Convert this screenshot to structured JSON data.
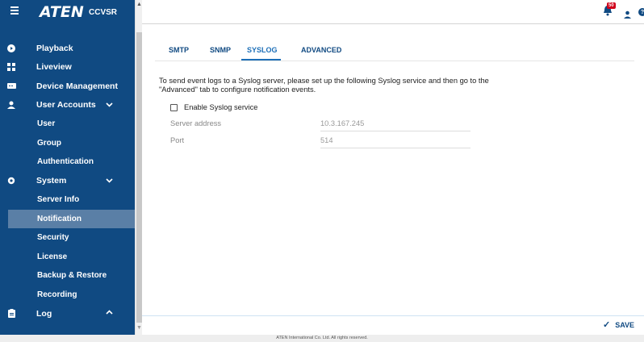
{
  "brand": {
    "logo": "ATEN",
    "product": "CCVSR"
  },
  "nav": {
    "playback": "Playback",
    "liveview": "Liveview",
    "device_management": "Device Management",
    "user_accounts": "User Accounts",
    "user": "User",
    "group": "Group",
    "authentication": "Authentication",
    "system": "System",
    "server_info": "Server Info",
    "notification": "Notification",
    "security": "Security",
    "license": "License",
    "backup_restore": "Backup & Restore",
    "recording": "Recording",
    "log": "Log"
  },
  "header": {
    "notification_count": "50"
  },
  "tabs": [
    "SMTP",
    "SNMP",
    "SYSLOG",
    "ADVANCED"
  ],
  "syslog": {
    "description": "To send event logs to a Syslog server, please set up the following Syslog service and then go to the \"Advanced\" tab to configure notification events.",
    "enable_label": "Enable Syslog service",
    "server_address_label": "Server address",
    "server_address_value": "10.3.167.245",
    "port_label": "Port",
    "port_value": "514"
  },
  "actions": {
    "save": "SAVE"
  },
  "footer": "ATEN International Co. Ltd. All rights reserved.",
  "colors": {
    "sidebar": "#104a82",
    "accent": "#1d6fb8",
    "badge": "#d0021b"
  }
}
